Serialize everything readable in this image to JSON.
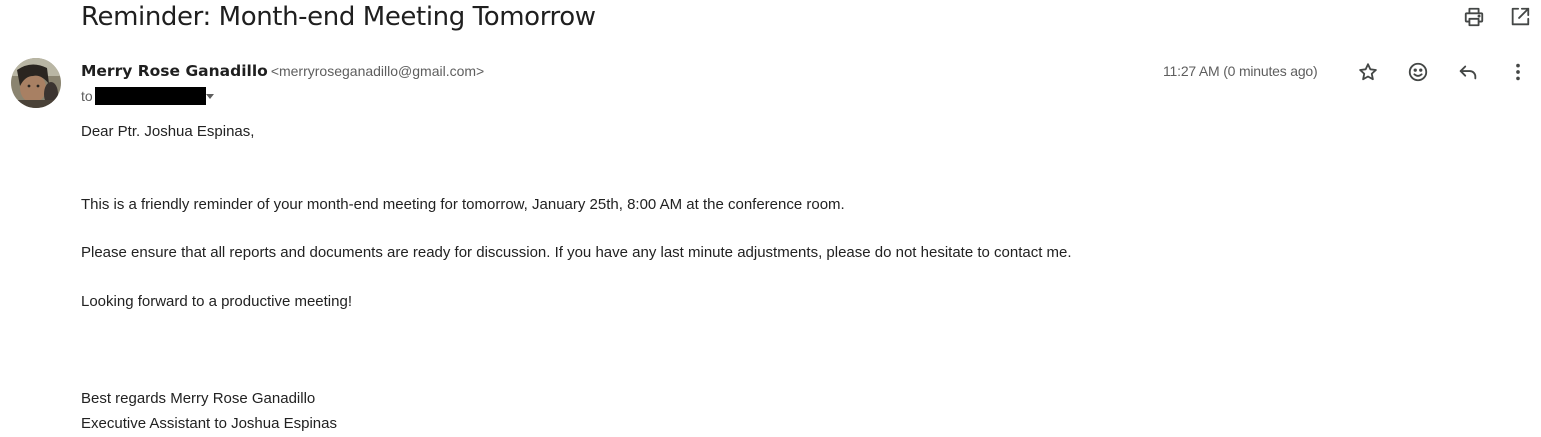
{
  "email": {
    "subject": "Reminder: Month-end Meeting Tomorrow",
    "sender_name": "Merry Rose Ganadillo",
    "sender_email": "<merryroseganadillo@gmail.com>",
    "to_label": "to",
    "timestamp": "11:27 AM (0 minutes ago)"
  },
  "body": {
    "greeting": "Dear Ptr. Joshua Espinas,",
    "paragraph1": "This is a friendly reminder of your month-end meeting for tomorrow, January 25th, 8:00 AM at the conference room.",
    "paragraph2": "Please ensure that all reports and documents are ready for discussion. If you have any last minute adjustments, please do not hesitate to contact me.",
    "paragraph3": "Looking forward to a productive meeting!",
    "signoff": "Best regards Merry Rose Ganadillo",
    "signature_title": "Executive Assistant to Joshua Espinas"
  },
  "icons": {
    "print": "print-icon",
    "open_new_window": "open-in-new-window-icon",
    "star": "star-icon",
    "emoji": "emoji-reaction-icon",
    "reply": "reply-icon",
    "more": "more-vertical-icon",
    "recipient_details": "chevron-down-icon"
  },
  "colors": {
    "text_primary": "#1f1f1f",
    "text_secondary": "#5e5e5e",
    "icon": "#444746",
    "redaction": "#000000"
  }
}
